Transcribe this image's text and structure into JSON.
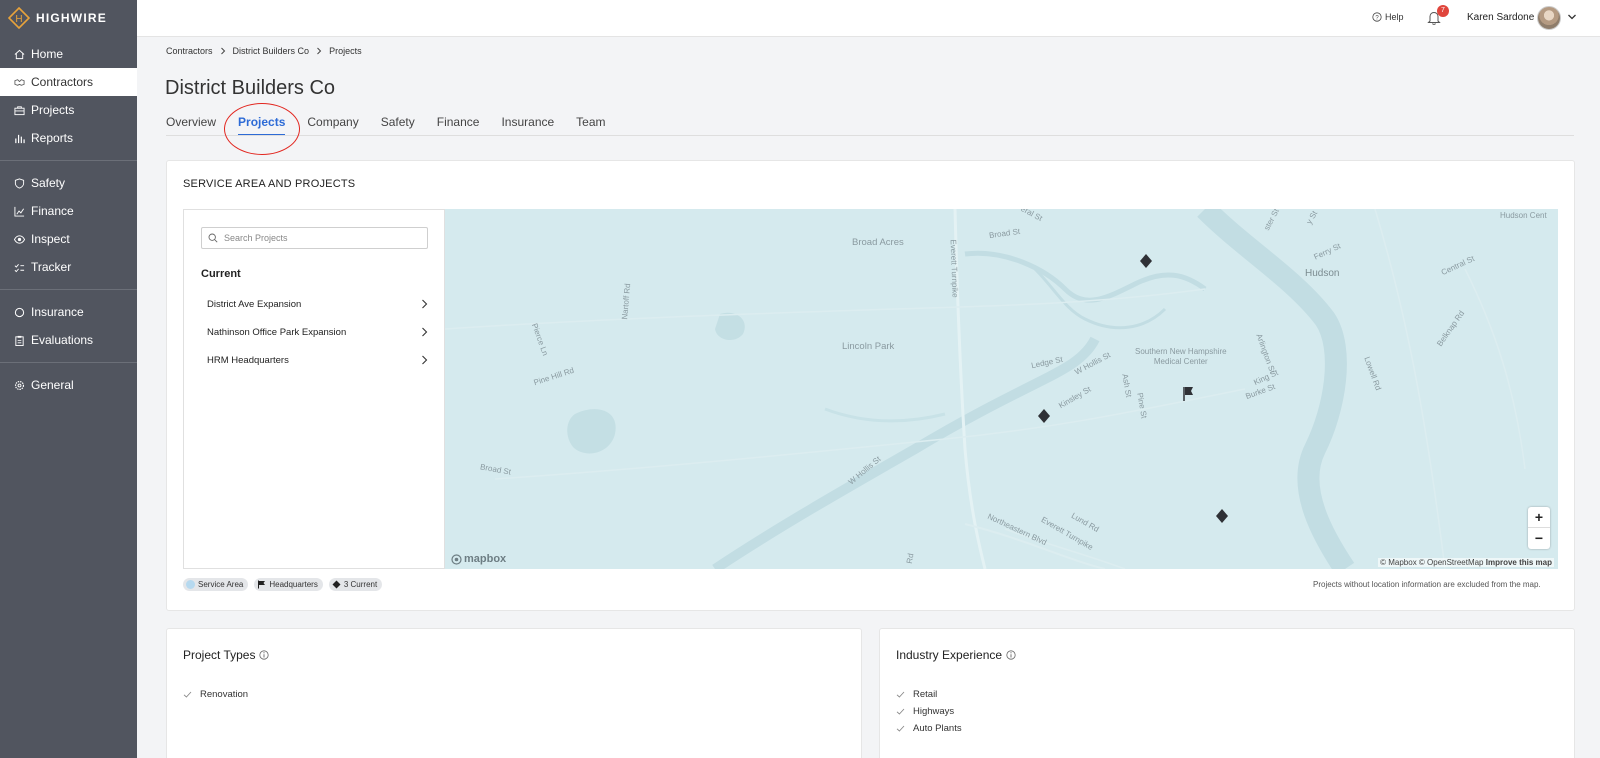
{
  "brand": {
    "name": "HIGHWIRE",
    "letter": "H",
    "accent": "#e8a33b"
  },
  "sidebar": {
    "groups": [
      [
        {
          "label": "Home",
          "icon": "home-icon"
        },
        {
          "label": "Contractors",
          "icon": "handshake-icon",
          "active": true
        },
        {
          "label": "Projects",
          "icon": "briefcase-icon"
        },
        {
          "label": "Reports",
          "icon": "bar-chart-icon"
        }
      ],
      [
        {
          "label": "Safety",
          "icon": "shield-icon"
        },
        {
          "label": "Finance",
          "icon": "line-chart-icon"
        },
        {
          "label": "Inspect",
          "icon": "eye-icon"
        },
        {
          "label": "Tracker",
          "icon": "checklist-icon"
        }
      ],
      [
        {
          "label": "Insurance",
          "icon": "circle-icon"
        },
        {
          "label": "Evaluations",
          "icon": "clipboard-icon"
        }
      ],
      [
        {
          "label": "General",
          "icon": "gear-icon"
        }
      ]
    ]
  },
  "topbar": {
    "help_label": "Help",
    "notification_count": "7",
    "user_name": "Karen Sardone"
  },
  "breadcrumb": [
    "Contractors",
    "District Builders Co",
    "Projects"
  ],
  "page": {
    "title": "District Builders Co",
    "tabs": [
      {
        "label": "Overview"
      },
      {
        "label": "Projects",
        "active": true
      },
      {
        "label": "Company"
      },
      {
        "label": "Safety"
      },
      {
        "label": "Finance"
      },
      {
        "label": "Insurance"
      },
      {
        "label": "Team"
      }
    ]
  },
  "service_area": {
    "title": "SERVICE AREA AND PROJECTS",
    "search_placeholder": "Search Projects",
    "current_label": "Current",
    "projects": [
      "District Ave Expansion",
      "Nathinson Office Park Expansion",
      "HRM Headquarters"
    ],
    "map_labels": {
      "broad_acres": "Broad Acres",
      "broad_st_top": "Broad St",
      "everett_turnpike": "Everett Turnpike",
      "hudson": "Hudson",
      "hudson_cent": "Hudson Cent",
      "ferry_st": "Ferry St",
      "central_st": "Central St",
      "lincoln_park": "Lincoln Park",
      "nartoff_rd": "Nartoff Rd",
      "pierce_ln": "Pierce Ln",
      "pine_hill_rd": "Pine Hill Rd",
      "broad_st_bottom": "Broad St",
      "w_hollis_st_bottom": "W Hollis St",
      "ledge_st": "Ledge St",
      "w_hollis_st_mid": "W Hollis St",
      "kinsley_st": "Kinsley St",
      "ash_st": "Ash St",
      "pine_st": "Pine St",
      "hospital": "Southern New Hampshire\nMedical Center",
      "arlington_st": "Arlington St",
      "king_st": "King St",
      "burke_st": "Burke St",
      "lowell_rd": "Lowell Rd",
      "belknap_rd": "Belknap Rd",
      "lund_rd": "Lund Rd",
      "northeastern_blvd": "Northeastern Blvd",
      "everett_turnpike_bottom": "Everett Turnpike",
      "rd_bottom": "Rd",
      "eral_st": "eral St",
      "y_st": "y St",
      "ster_st": "ster St"
    },
    "zoom_in": "+",
    "zoom_out": "−",
    "mapbox_logo": "mapbox",
    "attribution": "© Mapbox © OpenStreetMap",
    "improve_link": "Improve this map",
    "legend": [
      {
        "label": "Service Area",
        "icon": "service-area-dot-icon"
      },
      {
        "label": "Headquarters",
        "icon": "flag-icon"
      },
      {
        "label": "3 Current",
        "icon": "diamond-icon"
      }
    ],
    "note": "Projects without location information are excluded from the map."
  },
  "project_types": {
    "title": "Project Types",
    "items": [
      "Renovation"
    ]
  },
  "industry_experience": {
    "title": "Industry Experience",
    "items": [
      "Retail",
      "Highways",
      "Auto Plants"
    ]
  }
}
